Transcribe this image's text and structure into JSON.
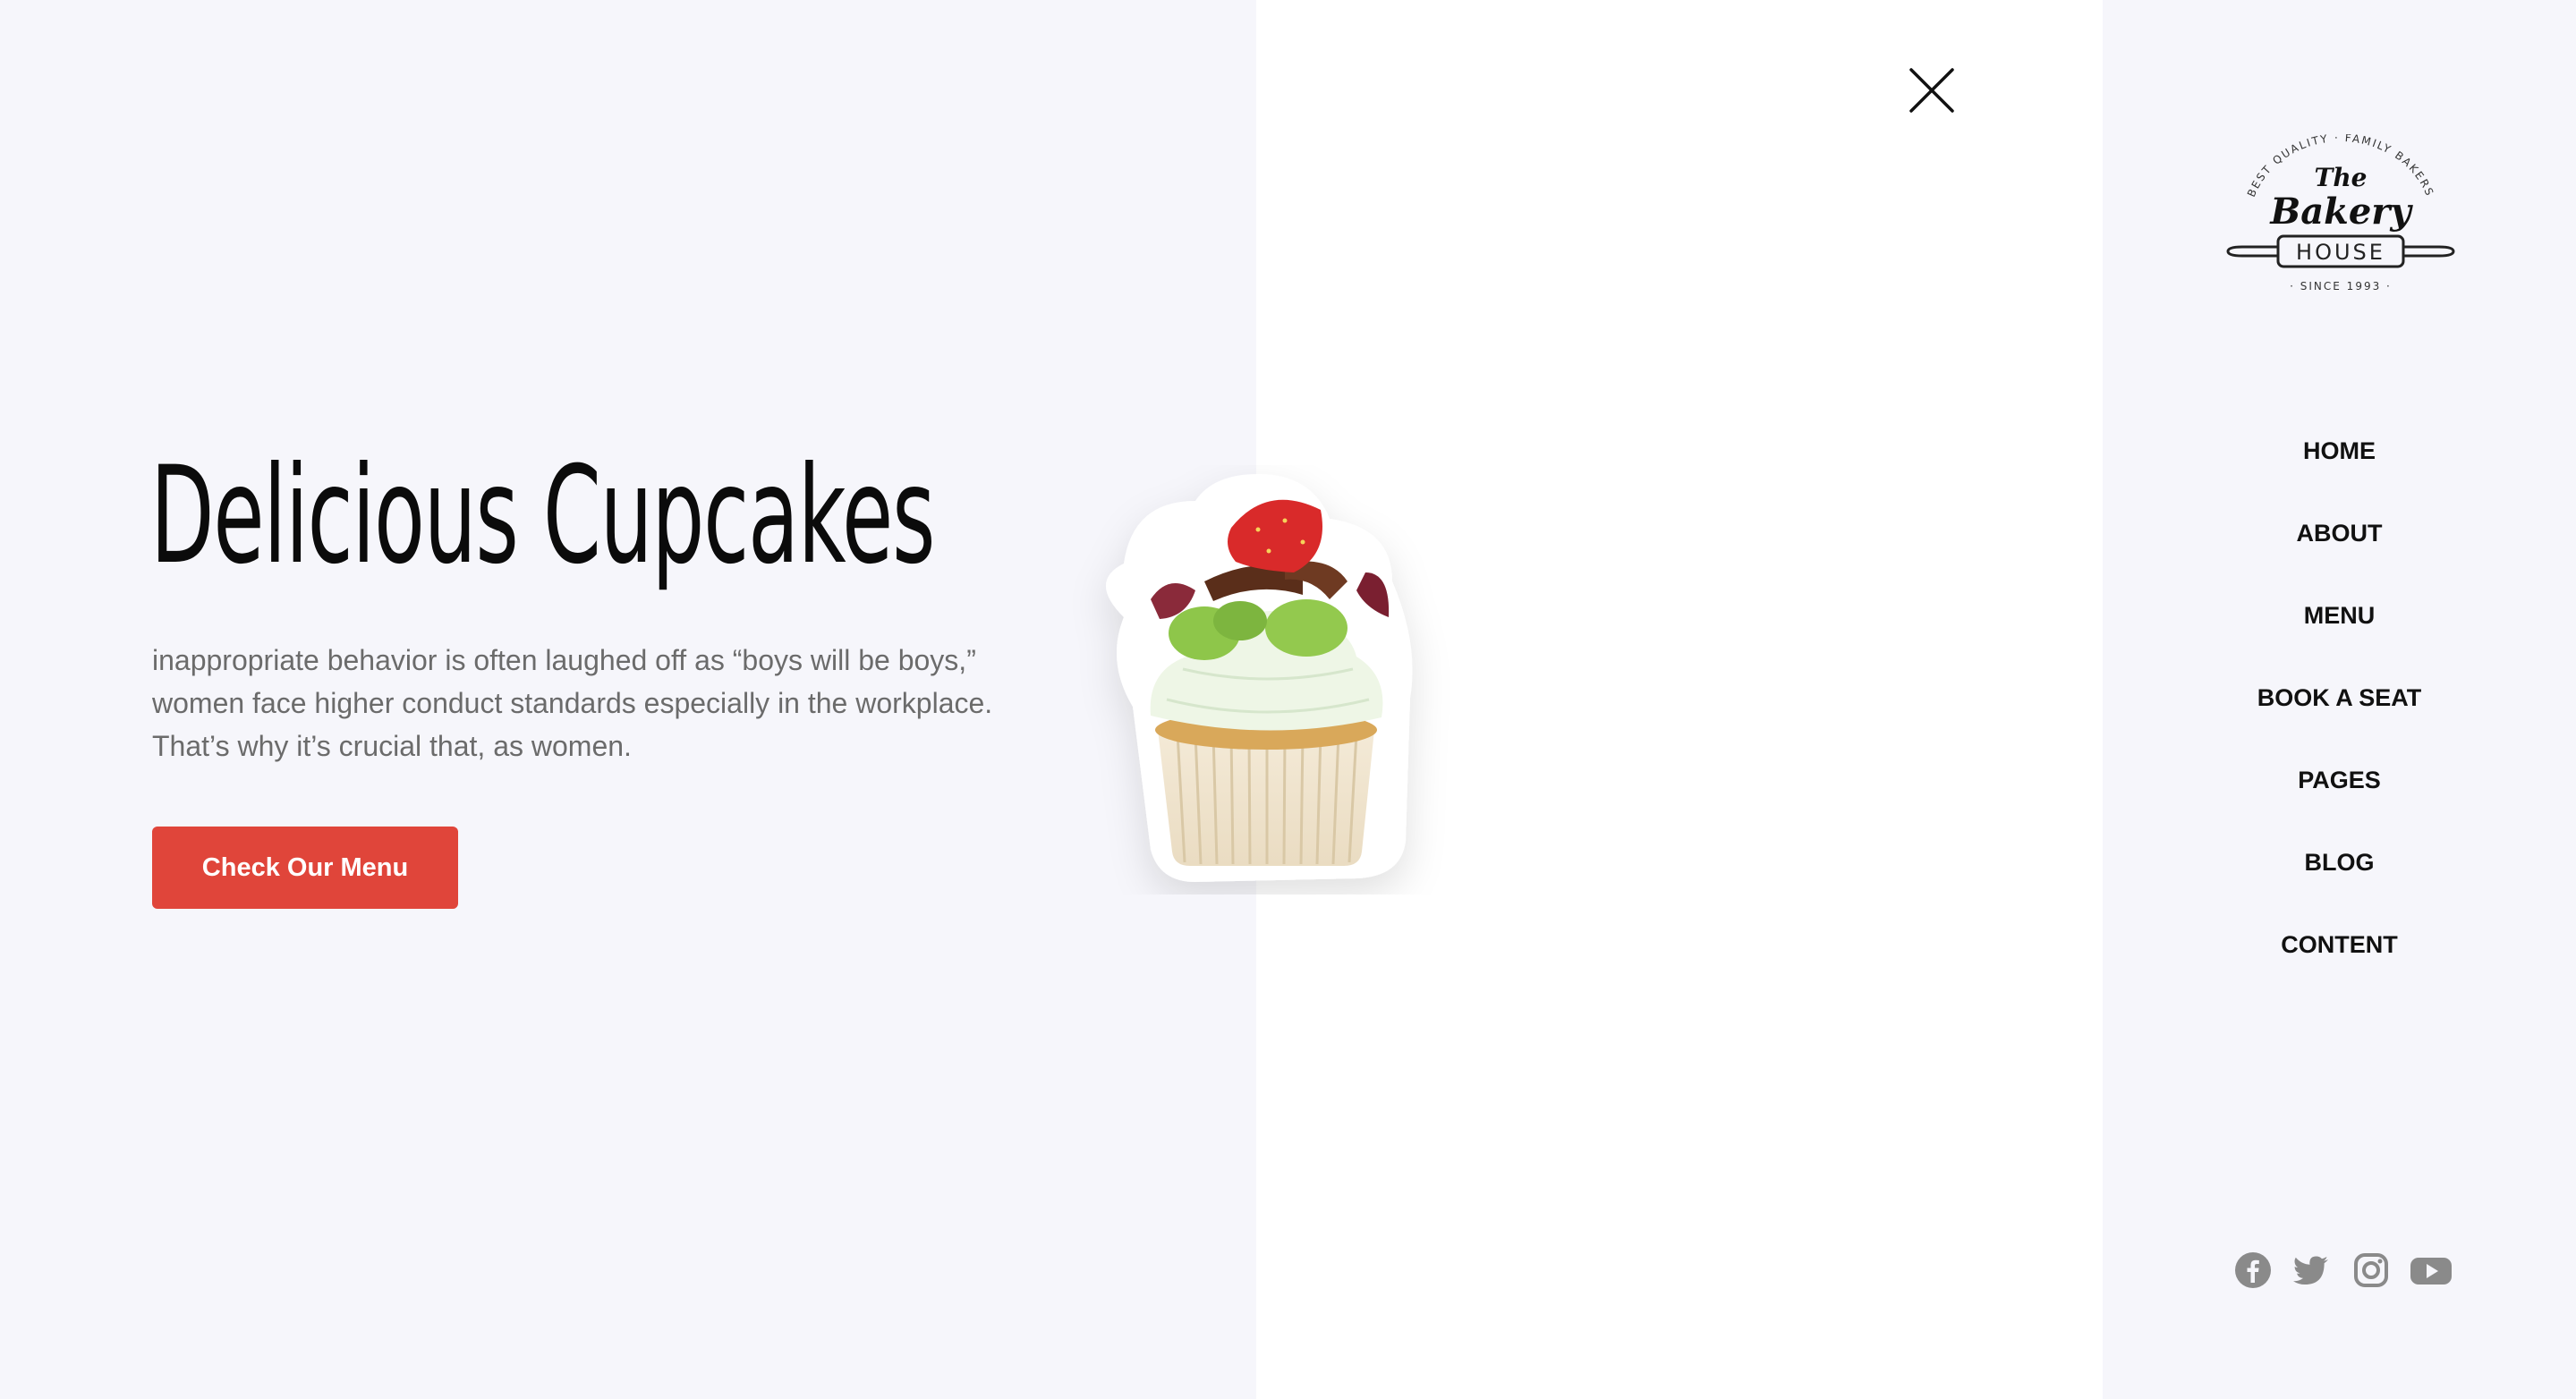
{
  "hero": {
    "title": "Delicious Cupcakes",
    "description": "inappropriate behavior is often laughed off as “boys will be boys,” women face higher conduct standards especially in the workplace. That’s why it’s crucial that, as women.",
    "cta_label": "Check Our Menu"
  },
  "logo": {
    "arc_text": "BEST QUALITY · FAMILY BAKERS",
    "line1": "The",
    "line2": "Bakery",
    "line3": "HOUSE",
    "since": "· SINCE 1993 ·"
  },
  "nav": {
    "items": [
      "HOME",
      "ABOUT",
      "MENU",
      "BOOK A SEAT",
      "PAGES",
      "BLOG",
      "CONTENT"
    ]
  },
  "social": [
    "facebook-icon",
    "twitter-icon",
    "instagram-icon",
    "youtube-icon"
  ],
  "colors": {
    "accent": "#e0453a",
    "panel_bg": "#f6f6fb",
    "text_dark": "#0b0b0b",
    "text_muted": "#6b6b6b",
    "icon_grey": "#8a8a8a"
  }
}
